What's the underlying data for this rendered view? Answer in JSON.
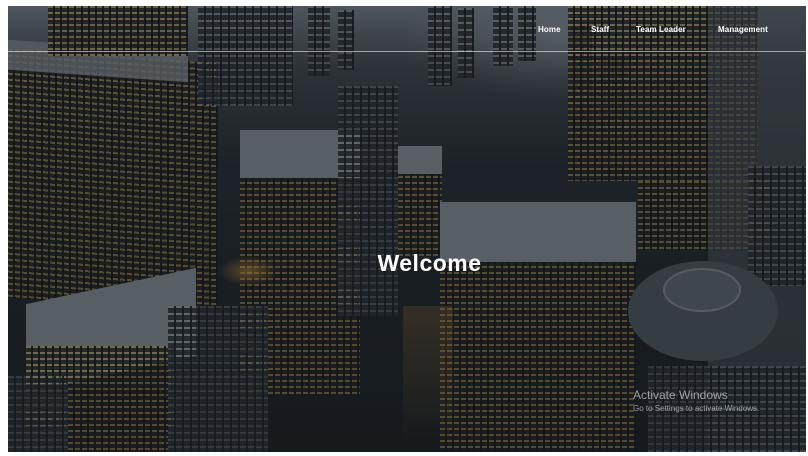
{
  "nav": {
    "items": [
      {
        "label": "Home"
      },
      {
        "label": "Staff"
      },
      {
        "label": "Team Leader"
      },
      {
        "label": "Management"
      }
    ]
  },
  "hero": {
    "heading": "Welcome",
    "background": "aerial city skyline at dusk"
  },
  "watermark": {
    "title": "Activate Windows",
    "subtitle": "Go to Settings to activate Windows."
  },
  "colors": {
    "text": "#ffffff",
    "overlay": "#12161a"
  }
}
